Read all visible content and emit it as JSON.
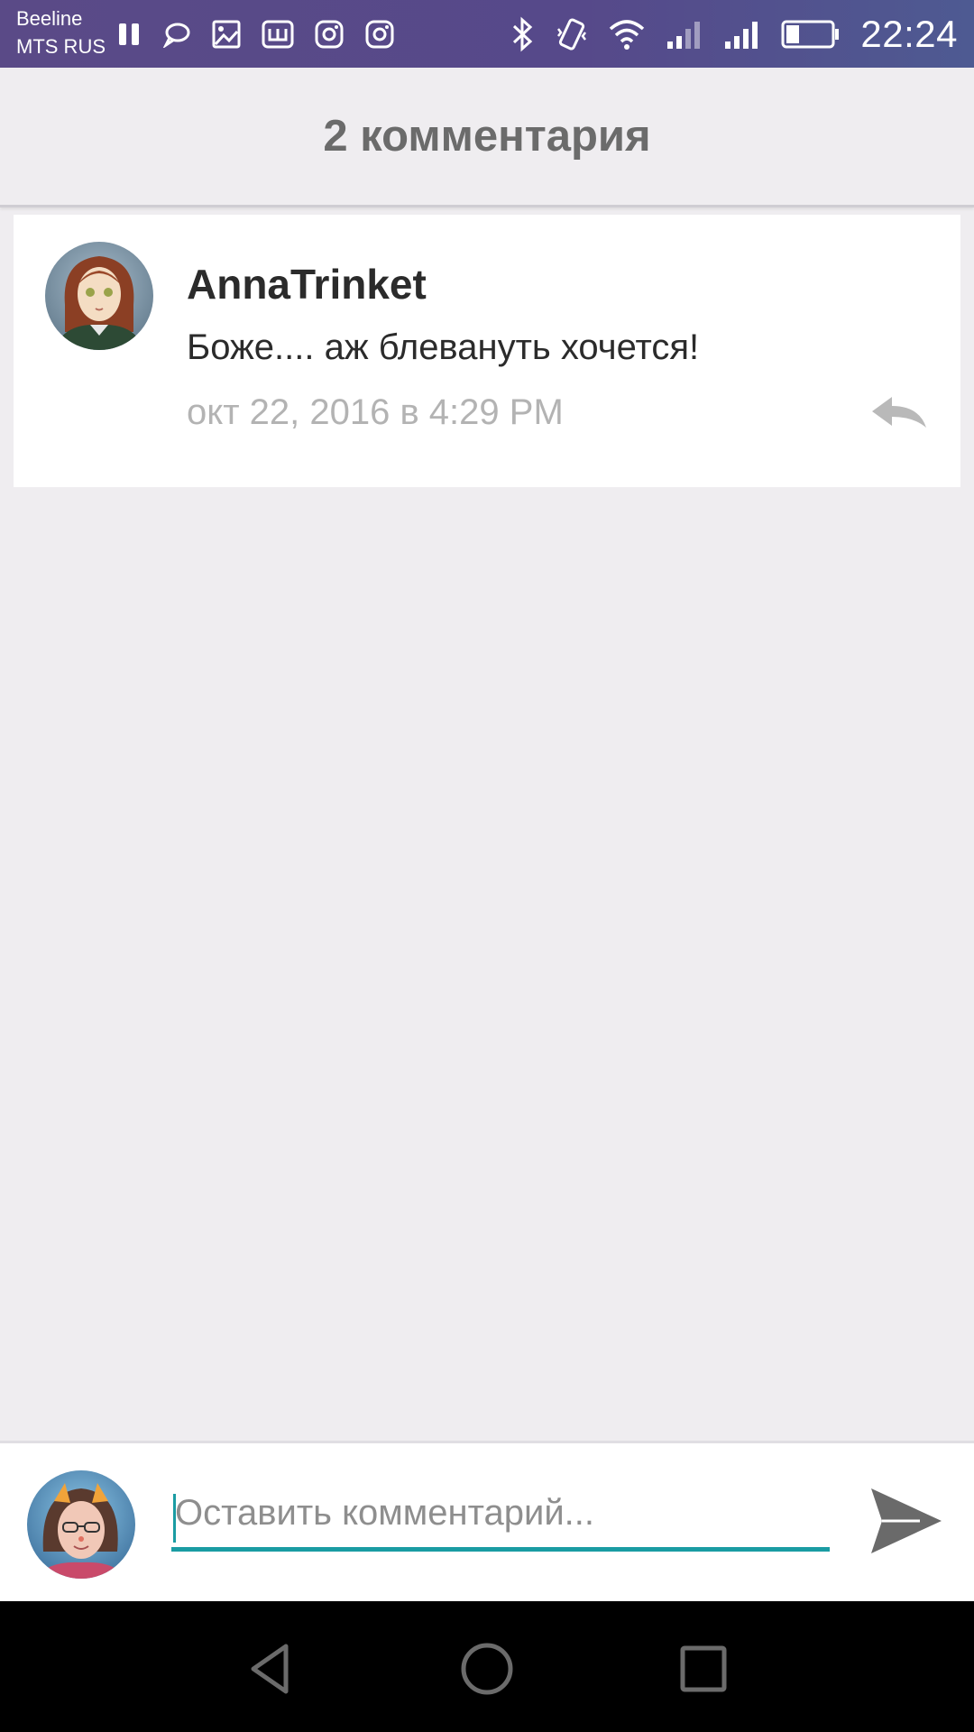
{
  "status_bar": {
    "carrier_line1": "Beeline",
    "carrier_line2": "MTS RUS",
    "time": "22:24",
    "notification_icons": [
      "pause-icon",
      "chat-bubble-icon",
      "gallery-icon",
      "app-w-icon",
      "instagram-icon",
      "instagram-icon"
    ],
    "system_icons": [
      "bluetooth-icon",
      "vibrate-icon",
      "wifi-icon",
      "signal-icon",
      "signal-icon",
      "battery-icon"
    ],
    "battery_level": 0.3
  },
  "header": {
    "title": "2 комментария"
  },
  "comments": [
    {
      "author": "AnnaTrinket",
      "text": "Боже.... аж блевануть хочется!",
      "date": "окт 22, 2016 в 4:29 PM"
    }
  ],
  "compose": {
    "placeholder": "Оставить комментарий...",
    "value": ""
  },
  "colors": {
    "status_bar": "#56498a",
    "accent": "#1a9ca3",
    "background": "#efedf0",
    "title_text": "#6b6b6b",
    "date_text": "#b3b3b3"
  }
}
